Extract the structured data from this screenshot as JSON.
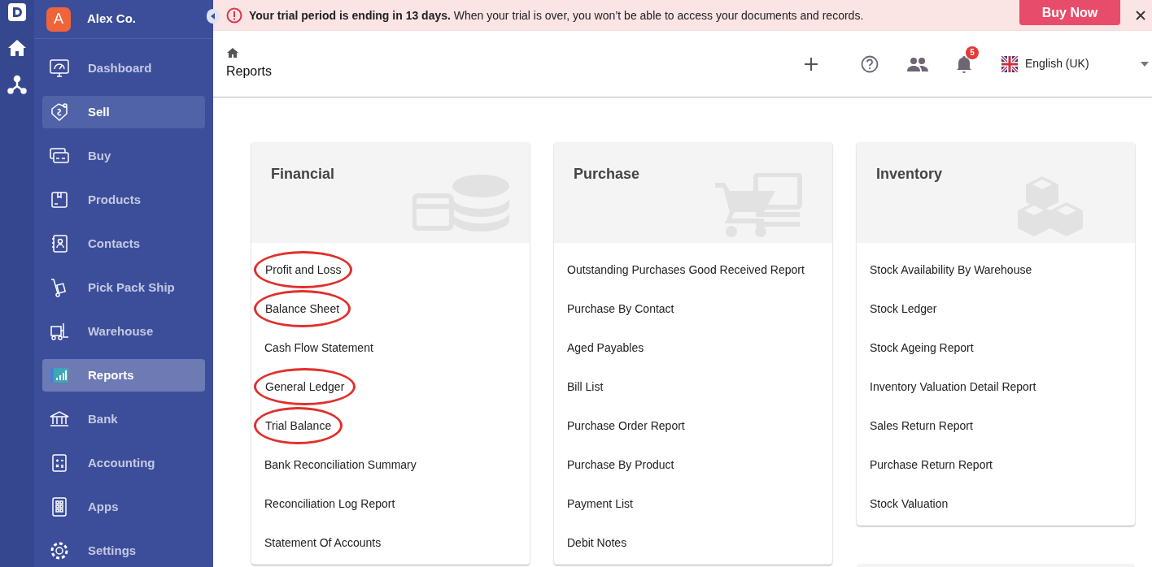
{
  "company": {
    "initial": "A",
    "name": "Alex Co."
  },
  "sidebar": {
    "items": [
      {
        "label": "Dashboard",
        "selected": false,
        "hovered": false
      },
      {
        "label": "Sell",
        "selected": false,
        "hovered": true
      },
      {
        "label": "Buy",
        "selected": false,
        "hovered": false
      },
      {
        "label": "Products",
        "selected": false,
        "hovered": false
      },
      {
        "label": "Contacts",
        "selected": false,
        "hovered": false
      },
      {
        "label": "Pick Pack Ship",
        "selected": false,
        "hovered": false
      },
      {
        "label": "Warehouse",
        "selected": false,
        "hovered": false
      },
      {
        "label": "Reports",
        "selected": true,
        "hovered": false
      },
      {
        "label": "Bank",
        "selected": false,
        "hovered": false
      },
      {
        "label": "Accounting",
        "selected": false,
        "hovered": false
      },
      {
        "label": "Apps",
        "selected": false,
        "hovered": false
      },
      {
        "label": "Settings",
        "selected": false,
        "hovered": false
      }
    ]
  },
  "banner": {
    "message": "**Your trial period is ending in 13 days.** When your trial is over, you won’t be able to access your documents and records.",
    "button": "Buy Now"
  },
  "header": {
    "title": "Reports",
    "notification_count": "5",
    "language": "English (UK)"
  },
  "cards": [
    {
      "title": "Financial",
      "items": [
        {
          "label": "Profit and Loss",
          "circled": true
        },
        {
          "label": "Balance Sheet",
          "circled": true
        },
        {
          "label": "Cash Flow Statement",
          "circled": false
        },
        {
          "label": "General Ledger",
          "circled": true
        },
        {
          "label": "Trial Balance",
          "circled": true
        },
        {
          "label": "Bank Reconciliation Summary",
          "circled": false
        },
        {
          "label": "Reconciliation Log Report",
          "circled": false
        },
        {
          "label": "Statement Of Accounts",
          "circled": false
        }
      ]
    },
    {
      "title": "Purchase",
      "items": [
        {
          "label": "Outstanding Purchases Good Received Report",
          "circled": false
        },
        {
          "label": "Purchase By Contact",
          "circled": false
        },
        {
          "label": "Aged Payables",
          "circled": false
        },
        {
          "label": "Bill List",
          "circled": false
        },
        {
          "label": "Purchase Order Report",
          "circled": false
        },
        {
          "label": "Purchase By Product",
          "circled": false
        },
        {
          "label": "Payment List",
          "circled": false
        },
        {
          "label": "Debit Notes",
          "circled": false
        }
      ]
    },
    {
      "title": "Inventory",
      "items": [
        {
          "label": "Stock Availability By Warehouse",
          "circled": false
        },
        {
          "label": "Stock Ledger",
          "circled": false
        },
        {
          "label": "Stock Ageing Report",
          "circled": false
        },
        {
          "label": "Inventory Valuation Detail Report",
          "circled": false
        },
        {
          "label": "Sales Return Report",
          "circled": false
        },
        {
          "label": "Purchase Return Report",
          "circled": false
        },
        {
          "label": "Stock Valuation",
          "circled": false
        }
      ]
    }
  ]
}
